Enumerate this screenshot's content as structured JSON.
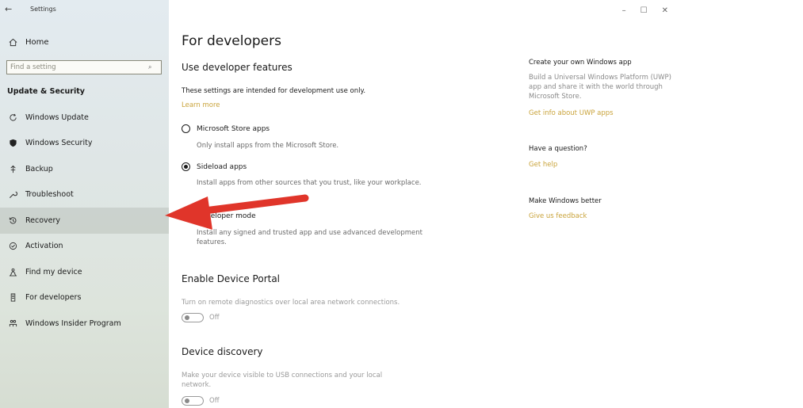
{
  "app_title": "Settings",
  "window_controls": {
    "minimize": "–",
    "maximize": "☐",
    "close": "✕"
  },
  "sidebar": {
    "home_label": "Home",
    "search_placeholder": "Find a setting",
    "section_label": "Update & Security",
    "items": [
      {
        "label": "Windows Update",
        "icon": "refresh-icon"
      },
      {
        "label": "Windows Security",
        "icon": "shield-icon"
      },
      {
        "label": "Backup",
        "icon": "backup-icon"
      },
      {
        "label": "Troubleshoot",
        "icon": "wrench-icon"
      },
      {
        "label": "Recovery",
        "icon": "recovery-icon",
        "active": true
      },
      {
        "label": "Activation",
        "icon": "check-circle-icon"
      },
      {
        "label": "Find my device",
        "icon": "person-pin-icon"
      },
      {
        "label": "For developers",
        "icon": "developer-tools-icon"
      },
      {
        "label": "Windows Insider Program",
        "icon": "insider-icon"
      }
    ]
  },
  "main": {
    "title": "For developers",
    "use_dev_features": {
      "heading": "Use developer features",
      "intro": "These settings are intended for development use only.",
      "learn_more": "Learn more",
      "options": [
        {
          "label": "Microsoft Store apps",
          "desc": "Only install apps from the Microsoft Store.",
          "selected": false
        },
        {
          "label": "Sideload apps",
          "desc": "Install apps from other sources that you trust, like your workplace.",
          "selected": true
        },
        {
          "label": "Developer mode",
          "desc": "Install any signed and trusted app and use advanced development features.",
          "selected": false
        }
      ]
    },
    "device_portal": {
      "heading": "Enable Device Portal",
      "desc": "Turn on remote diagnostics over local area network connections.",
      "toggle": "Off"
    },
    "device_discovery": {
      "heading": "Device discovery",
      "desc": "Make your device visible to USB connections and your local network.",
      "toggle": "Off"
    }
  },
  "right_pane": {
    "create_app": {
      "heading": "Create your own Windows app",
      "text": "Build a Universal Windows Platform (UWP) app and share it with the world through Microsoft Store.",
      "link": "Get info about UWP apps"
    },
    "question": {
      "heading": "Have a question?",
      "link": "Get help"
    },
    "better": {
      "heading": "Make Windows better",
      "link": "Give us feedback"
    }
  },
  "colors": {
    "link": "#c9a33a",
    "arrow": "#e0352a"
  }
}
